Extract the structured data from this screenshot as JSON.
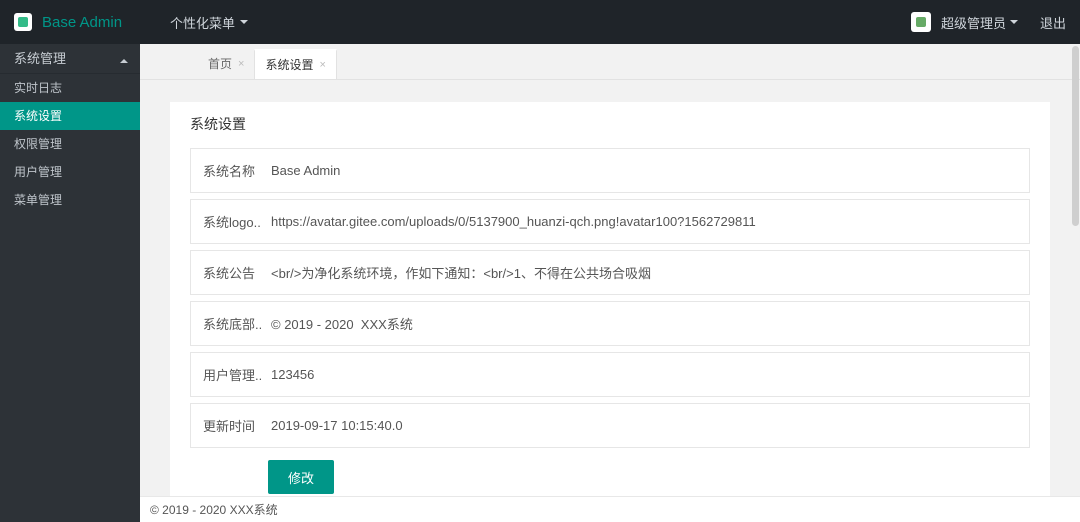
{
  "nav": {
    "brand": "Base Admin",
    "personalize": "个性化菜单",
    "username": "超级管理员",
    "logout": "退出"
  },
  "sidebar": {
    "group_label": "系统管理",
    "items": [
      {
        "label": "实时日志",
        "active": false
      },
      {
        "label": "系统设置",
        "active": true
      },
      {
        "label": "权限管理",
        "active": false
      },
      {
        "label": "用户管理",
        "active": false
      },
      {
        "label": "菜单管理",
        "active": false
      }
    ]
  },
  "tabs": [
    {
      "label": "首页",
      "active": false
    },
    {
      "label": "系统设置",
      "active": true
    }
  ],
  "form": {
    "title": "系统设置",
    "rows": [
      {
        "label": "系统名称",
        "value": "Base Admin"
      },
      {
        "label": "系统logo...",
        "value": "https://avatar.gitee.com/uploads/0/5137900_huanzi-qch.png!avatar100?1562729811"
      },
      {
        "label": "系统公告",
        "value": "<br/>为净化系统环境，作如下通知：<br/>1、不得在公共场合吸烟"
      },
      {
        "label": "系统底部...",
        "value": "© 2019 - 2020  XXX系统"
      },
      {
        "label": "用户管理...",
        "value": "123456"
      },
      {
        "label": "更新时间",
        "value": "2019-09-17 10:15:40.0"
      }
    ],
    "save_label": "修改"
  },
  "footer": "© 2019 - 2020 XXX系统"
}
